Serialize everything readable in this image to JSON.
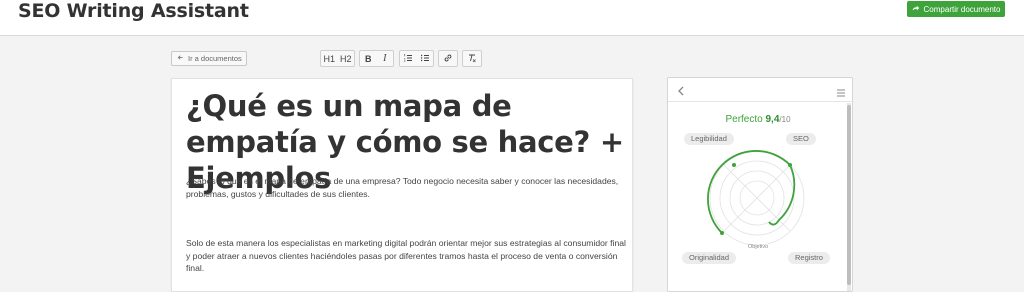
{
  "header": {
    "app_title": "SEO Writing Assistant",
    "share_label": "Compartir documento",
    "share_icon": "share-arrow-icon",
    "accent": "#3ea33a"
  },
  "toolbar": {
    "back_label": "Ir a documentos",
    "back_icon": "arrow-left-icon",
    "h1_label": "H1",
    "h2_label": "H2",
    "bold_label": "B",
    "italic_label": "I",
    "icons": [
      "heading-1-icon",
      "heading-2-icon",
      "bold-icon",
      "italic-icon",
      "ordered-list-icon",
      "bullet-list-icon",
      "link-icon",
      "clear-format-icon"
    ]
  },
  "document": {
    "title": "¿Qué es un mapa de empatía y cómo se hace? + Ejemplos",
    "paragraphs": [
      "¿Sabes lo que es el mapa de empatía de una empresa? Todo negocio necesita saber y conocer las necesidades, problemas, gustos y dificultades de sus clientes.",
      "Solo de esta manera los especialistas en marketing digital podrán orientar mejor sus estrategias al consumidor final y poder atraer a nuevos clientes haciéndoles pasas por diferentes tramos hasta el proceso de venta o conversión final."
    ]
  },
  "panel": {
    "score_label": "Perfecto",
    "score_value": "9,4",
    "score_max": "/10",
    "radar_labels": {
      "top_left": "Legibilidad",
      "top_right": "SEO",
      "bottom_left": "Originalidad",
      "bottom_right": "Registro",
      "center": "Objetivo"
    },
    "score_color": "#3ea33a",
    "icons": [
      "chevron-left-icon",
      "menu-icon"
    ]
  }
}
